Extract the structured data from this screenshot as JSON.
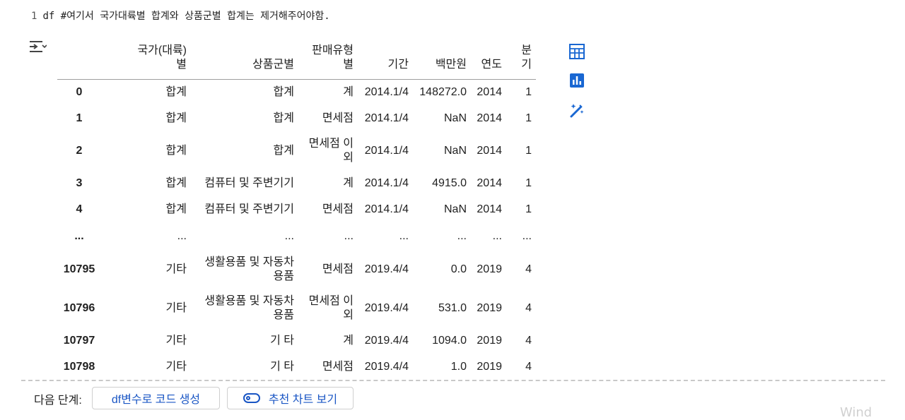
{
  "code": {
    "line_number": "1",
    "text": "df #여기서 국가대륙별 합계와 상품군별 합계는 제거해주어야함."
  },
  "table": {
    "headers": [
      "",
      "국가(대륙)별",
      "상품군별",
      "판매유형별",
      "기간",
      "백만원",
      "연도",
      "분기"
    ],
    "rows": [
      {
        "index": "0",
        "country": "합계",
        "product": "합계",
        "type": "계",
        "period": "2014.1/4",
        "amount": "148272.0",
        "year": "2014",
        "quarter": "1"
      },
      {
        "index": "1",
        "country": "합계",
        "product": "합계",
        "type": "면세점",
        "period": "2014.1/4",
        "amount": "NaN",
        "year": "2014",
        "quarter": "1"
      },
      {
        "index": "2",
        "country": "합계",
        "product": "합계",
        "type": "면세점 이외",
        "period": "2014.1/4",
        "amount": "NaN",
        "year": "2014",
        "quarter": "1"
      },
      {
        "index": "3",
        "country": "합계",
        "product": "컴퓨터 및 주변기기",
        "type": "계",
        "period": "2014.1/4",
        "amount": "4915.0",
        "year": "2014",
        "quarter": "1"
      },
      {
        "index": "4",
        "country": "합계",
        "product": "컴퓨터 및 주변기기",
        "type": "면세점",
        "period": "2014.1/4",
        "amount": "NaN",
        "year": "2014",
        "quarter": "1"
      },
      {
        "index": "...",
        "country": "...",
        "product": "...",
        "type": "...",
        "period": "...",
        "amount": "...",
        "year": "...",
        "quarter": "..."
      },
      {
        "index": "10795",
        "country": "기타",
        "product": "생활용품 및 자동차용품",
        "type": "면세점",
        "period": "2019.4/4",
        "amount": "0.0",
        "year": "2019",
        "quarter": "4"
      },
      {
        "index": "10796",
        "country": "기타",
        "product": "생활용품 및 자동차용품",
        "type": "면세점 이외",
        "period": "2019.4/4",
        "amount": "531.0",
        "year": "2019",
        "quarter": "4"
      },
      {
        "index": "10797",
        "country": "기타",
        "product": "기 타",
        "type": "계",
        "period": "2019.4/4",
        "amount": "1094.0",
        "year": "2019",
        "quarter": "4"
      },
      {
        "index": "10798",
        "country": "기타",
        "product": "기 타",
        "type": "면세점",
        "period": "2019.4/4",
        "amount": "1.0",
        "year": "2019",
        "quarter": "4"
      }
    ]
  },
  "side_icons": [
    "table-icon",
    "chart-icon",
    "magic-wand-icon"
  ],
  "next_steps": {
    "label": "다음 단계:",
    "btn_code": "df변수로 코드 생성",
    "btn_chart": "추천 차트 보기"
  },
  "watermark": "Wind",
  "colors": {
    "accent": "#1a56c4",
    "icon_blue": "#1967d2"
  }
}
